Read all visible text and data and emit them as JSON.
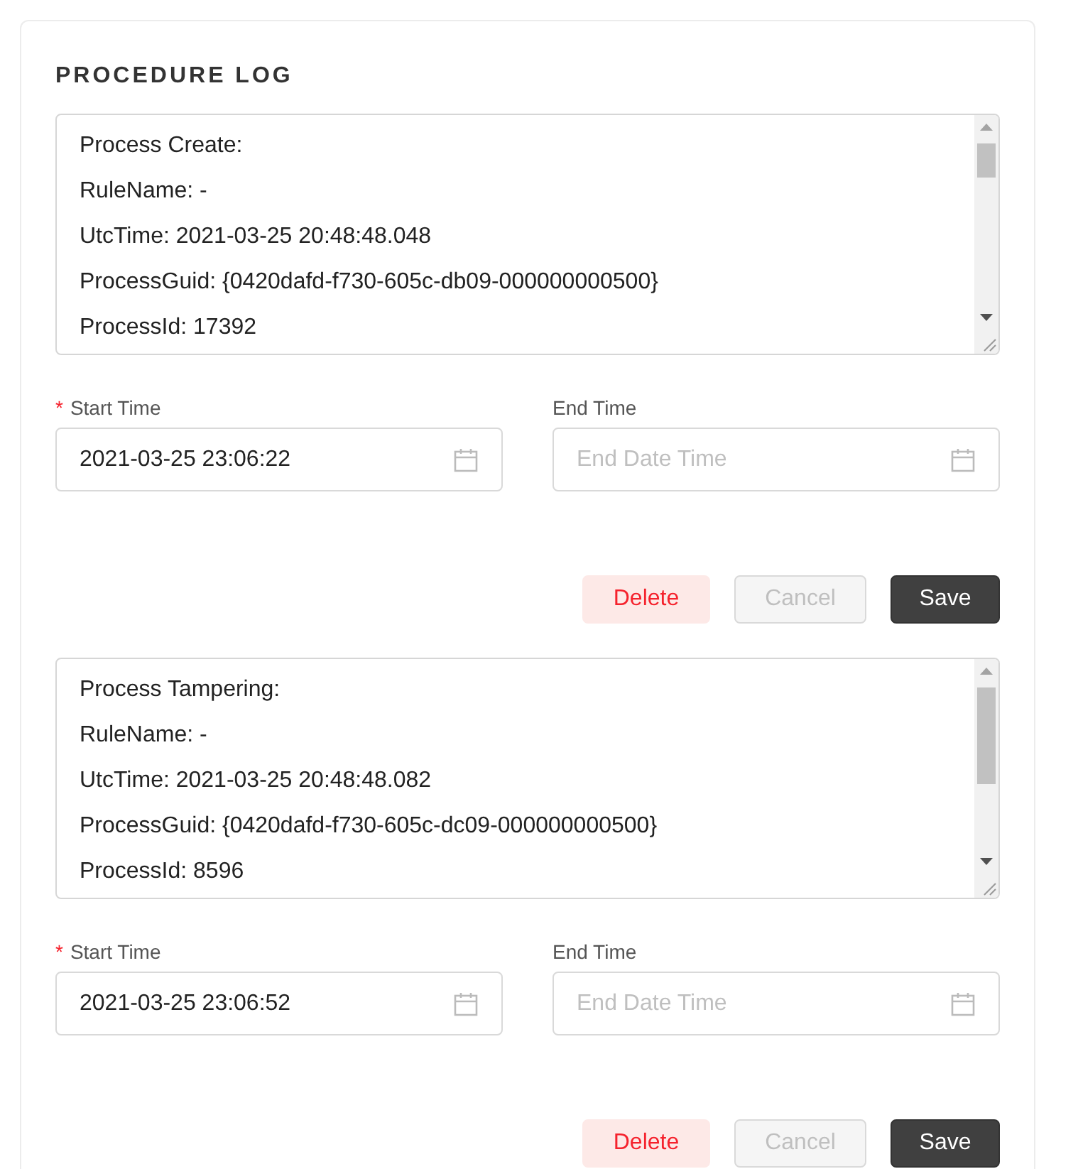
{
  "title": "PROCEDURE LOG",
  "entries": [
    {
      "log": [
        "Process Create:",
        "RuleName: -",
        "UtcTime: 2021-03-25 20:48:48.048",
        "ProcessGuid: {0420dafd-f730-605c-db09-000000000500}",
        "ProcessId: 17392"
      ],
      "fields": [
        {
          "label": "Start Time",
          "required_mark": "*",
          "value": "2021-03-25 23:06:22"
        },
        {
          "label": "End Time",
          "placeholder": "End Date Time"
        }
      ],
      "buttons": [
        {
          "label": "Delete",
          "kind": "danger",
          "disabled": false
        },
        {
          "label": "Cancel",
          "kind": "default",
          "disabled": true
        },
        {
          "label": "Save",
          "kind": "primary",
          "disabled": false
        }
      ]
    },
    {
      "log": [
        "Process Tampering:",
        "RuleName: -",
        "UtcTime: 2021-03-25 20:48:48.082",
        "ProcessGuid: {0420dafd-f730-605c-dc09-000000000500}",
        "ProcessId: 8596"
      ],
      "fields": [
        {
          "label": "Start Time",
          "required_mark": "*",
          "value": "2021-03-25 23:06:52"
        },
        {
          "label": "End Time",
          "placeholder": "End Date Time"
        }
      ],
      "buttons": [
        {
          "label": "Delete",
          "kind": "danger",
          "disabled": false
        },
        {
          "label": "Cancel",
          "kind": "default",
          "disabled": true
        },
        {
          "label": "Save",
          "kind": "primary",
          "disabled": false
        }
      ]
    }
  ]
}
